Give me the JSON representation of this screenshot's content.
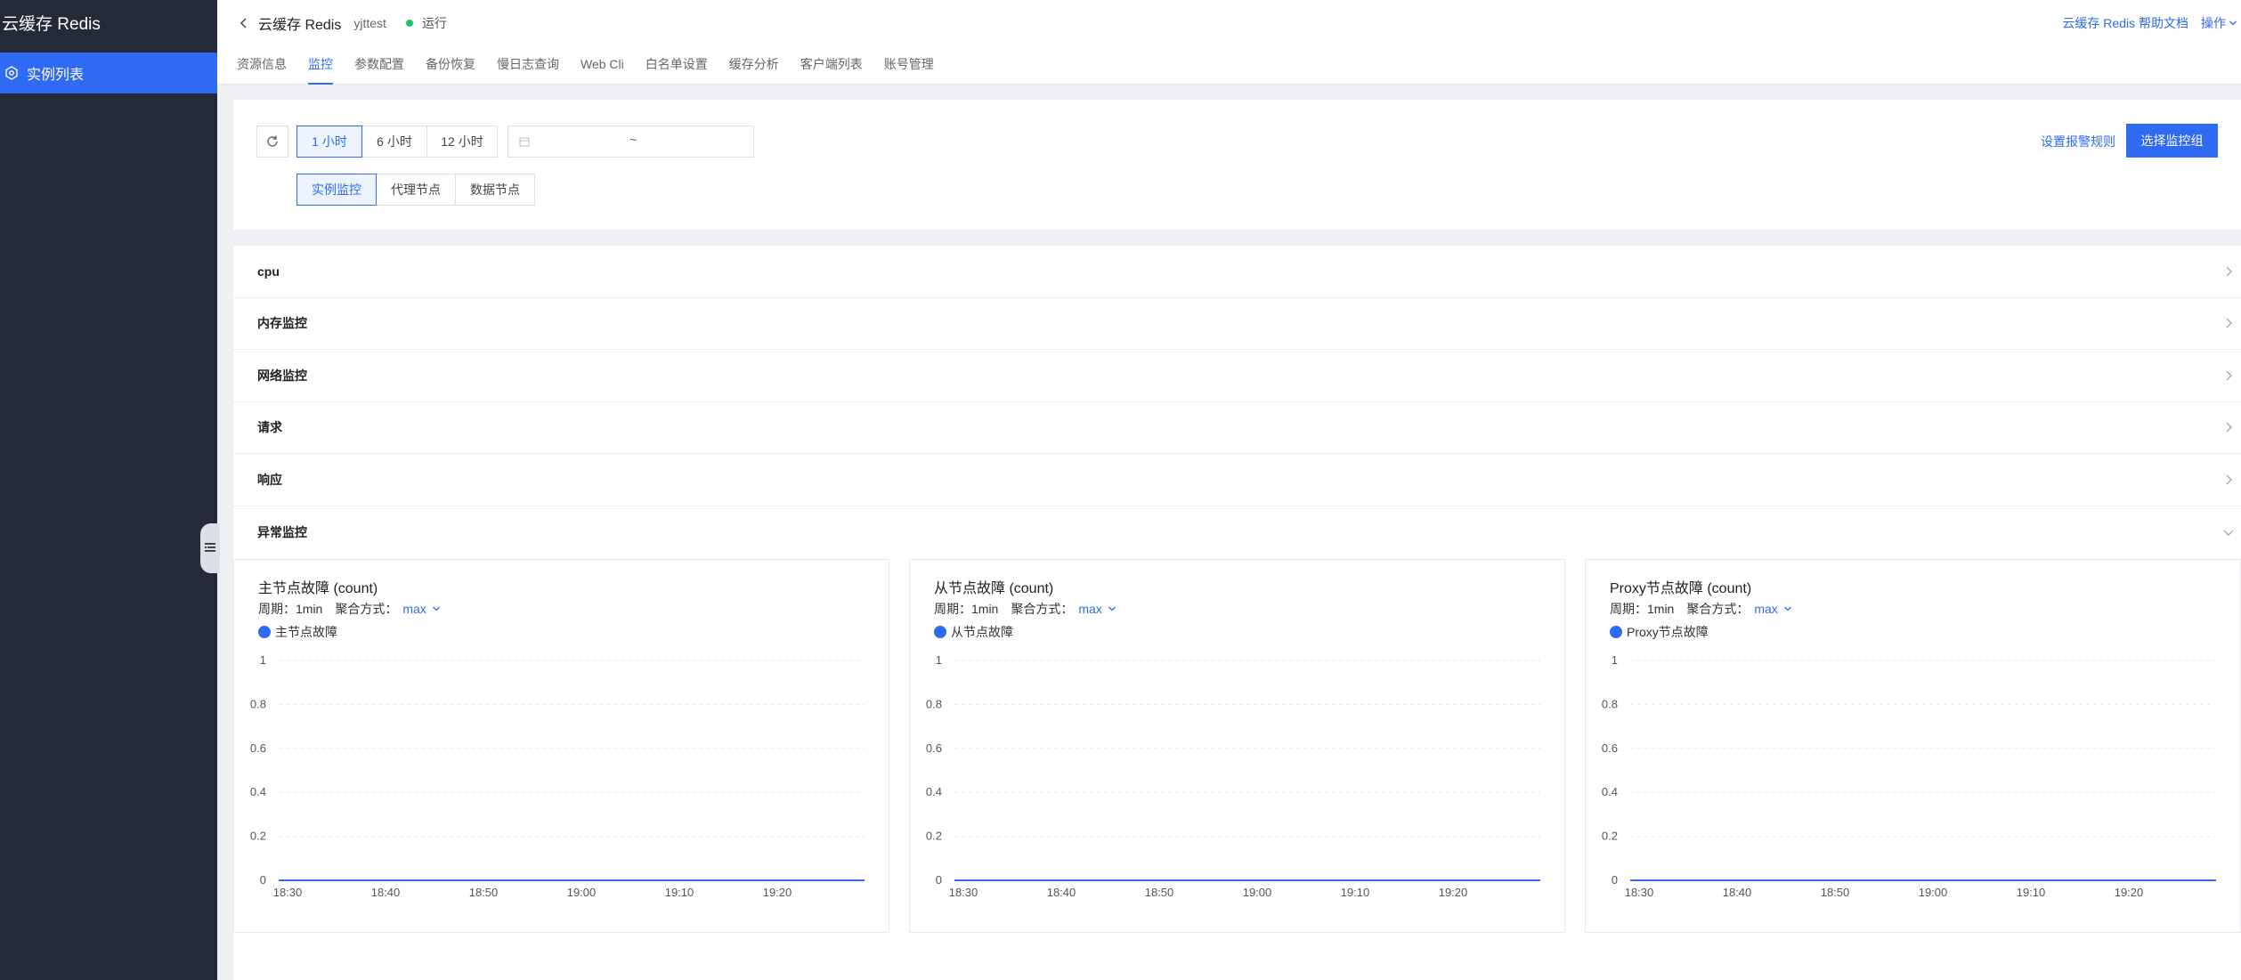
{
  "sidebar": {
    "title": "云缓存 Redis",
    "items": [
      {
        "label": "实例列表"
      }
    ]
  },
  "header": {
    "service": "云缓存 Redis",
    "instance": "yjttest",
    "status": "运行",
    "help": "云缓存 Redis 帮助文档",
    "ops": "操作",
    "tabs": [
      "资源信息",
      "监控",
      "参数配置",
      "备份恢复",
      "慢日志查询",
      "Web Cli",
      "白名单设置",
      "缓存分析",
      "客户端列表",
      "账号管理"
    ],
    "active_tab": 1
  },
  "toolbar": {
    "time_ranges": [
      "1 小时",
      "6 小时",
      "12 小时"
    ],
    "date_separator": "~",
    "views": [
      "实例监控",
      "代理节点",
      "数据节点"
    ],
    "alarm_link": "设置报警规则",
    "select_group": "选择监控组"
  },
  "sections": [
    "cpu",
    "内存监控",
    "网络监控",
    "请求",
    "响应",
    "异常监控"
  ],
  "charts_meta": {
    "period_label": "周期：",
    "period": "1min",
    "agg_label": "聚合方式：",
    "agg": "max"
  },
  "chart_data": [
    {
      "type": "line",
      "title": "主节点故障 (count)",
      "series": [
        {
          "name": "主节点故障",
          "x": [
            "18:30",
            "18:40",
            "18:50",
            "19:00",
            "19:10",
            "19:20"
          ],
          "values": [
            0,
            0,
            0,
            0,
            0,
            0
          ]
        }
      ],
      "x_ticks": [
        "18:30",
        "18:40",
        "18:50",
        "19:00",
        "19:10",
        "19:20"
      ],
      "y_ticks": [
        "1",
        "0.8",
        "0.6",
        "0.4",
        "0.2",
        "0"
      ],
      "ylim": [
        0,
        1
      ],
      "grid": true,
      "legend": "top-left",
      "color": "#2f6af2"
    },
    {
      "type": "line",
      "title": "从节点故障 (count)",
      "series": [
        {
          "name": "从节点故障",
          "x": [
            "18:30",
            "18:40",
            "18:50",
            "19:00",
            "19:10",
            "19:20"
          ],
          "values": [
            0,
            0,
            0,
            0,
            0,
            0
          ]
        }
      ],
      "x_ticks": [
        "18:30",
        "18:40",
        "18:50",
        "19:00",
        "19:10",
        "19:20"
      ],
      "y_ticks": [
        "1",
        "0.8",
        "0.6",
        "0.4",
        "0.2",
        "0"
      ],
      "ylim": [
        0,
        1
      ],
      "grid": true,
      "legend": "top-left",
      "color": "#2f6af2"
    },
    {
      "type": "line",
      "title": "Proxy节点故障 (count)",
      "series": [
        {
          "name": "Proxy节点故障",
          "x": [
            "18:30",
            "18:40",
            "18:50",
            "19:00",
            "19:10",
            "19:20"
          ],
          "values": [
            0,
            0,
            0,
            0,
            0,
            0
          ]
        }
      ],
      "x_ticks": [
        "18:30",
        "18:40",
        "18:50",
        "19:00",
        "19:10",
        "19:20"
      ],
      "y_ticks": [
        "1",
        "0.8",
        "0.6",
        "0.4",
        "0.2",
        "0"
      ],
      "ylim": [
        0,
        1
      ],
      "grid": true,
      "legend": "top-left",
      "color": "#2f6af2"
    }
  ]
}
